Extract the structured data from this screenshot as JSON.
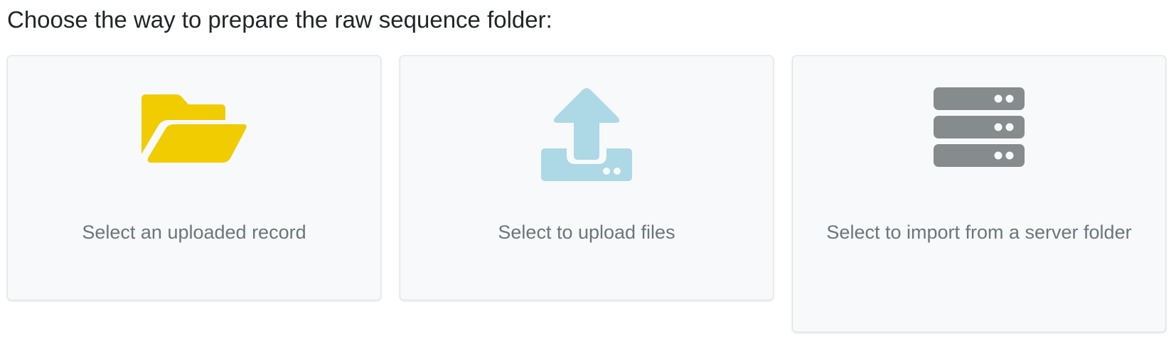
{
  "prompt": "Choose the way to prepare the raw sequence folder:",
  "options": [
    {
      "label": "Select an uploaded record",
      "icon": "folder-open-icon",
      "color": "#f0cc00"
    },
    {
      "label": "Select to upload files",
      "icon": "upload-icon",
      "color": "#add8e6"
    },
    {
      "label": "Select to import from a server folder",
      "icon": "server-icon",
      "color": "#868b8e"
    }
  ]
}
